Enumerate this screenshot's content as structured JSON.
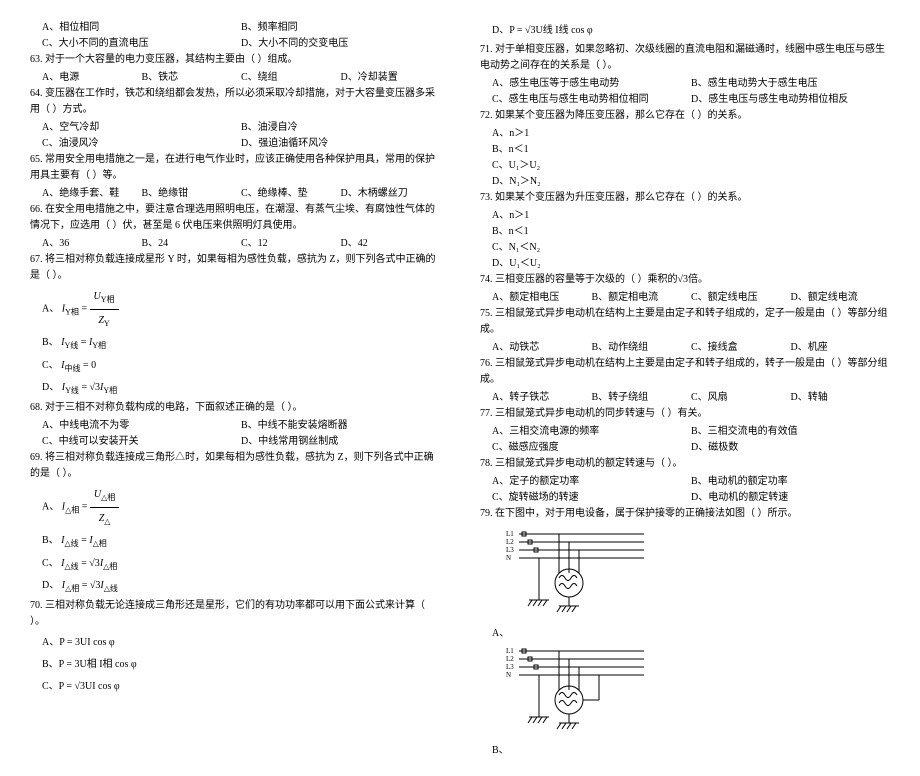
{
  "col1": {
    "q63_opts_pre": {
      "a": "A、相位相同",
      "b": "B、频率相同",
      "c": "C、大小不同的直流电压",
      "d": "D、大小不同的交变电压"
    },
    "q63": "63. 对于一个大容量的电力变压器，其结构主要由（   ）组成。",
    "q63_opts": {
      "a": "A、电源",
      "b": "B、铁芯",
      "c": "C、绕组",
      "d": "D、冷却装置"
    },
    "q64": "64. 变压器在工作时，铁芯和绕组都会发热，所以必须采取冷却措施，对于大容量变压器多采用（   ）方式。",
    "q64_opts": {
      "a": "A、空气冷却",
      "b": "B、油浸自冷",
      "c": "C、油浸风冷",
      "d": "D、强迫油循环风冷"
    },
    "q65": "65. 常用安全用电措施之一是，在进行电气作业时，应该正确使用各种保护用具，常用的保护用具主要有（   ）等。",
    "q65_opts": {
      "a": "A、绝缘手套、鞋",
      "b": "B、绝缘钳",
      "c": "C、绝缘棒、垫",
      "d": "D、木柄螺丝刀"
    },
    "q66": "66. 在安全用电措施之中，要注意合理选用照明电压，在潮湿、有蒸气尘埃、有腐蚀性气体的情况下，应选用（   ）伏，甚至是 6 伏电压来供照明灯具使用。",
    "q66_opts": {
      "a": "A、36",
      "b": "B、24",
      "c": "C、12",
      "d": "D、42"
    },
    "q67": "67. 将三相对称负载连接成星形 Y 时，如果每相为感性负载，感抗为 Z，则下列各式中正确的是（   ）。",
    "q67_a_label": "A、",
    "q67_b_label": "B、",
    "q67_c_label": "C、",
    "q67_d_label": "D、",
    "q67_formula_a_left": "I",
    "q67_formula_a_sub": "Y相",
    "q67_formula_a_num": "U",
    "q67_formula_a_numsub": "Y相",
    "q67_formula_a_den": "Z",
    "q67_formula_a_densub": "Y",
    "q67_b": "I Y线 = I Y相",
    "q67_c": "I 中线 = 0",
    "q67_d": "I Y线 = √3 I Y相",
    "q68": "68. 对于三相不对称负载构成的电路，下面叙述正确的是（   ）。",
    "q68_opts": {
      "a": "A、中线电流不为零",
      "b": "B、中线不能安装熔断器",
      "c": "C、中线可以安装开关",
      "d": "D、中线常用钢丝制成"
    },
    "q69": "69. 将三相对称负载连接成三角形△时，如果每相为感性负载，感抗为 Z，则下列各式中正确的是（   ）。",
    "q69_a_label": "A、",
    "q69_b_label": "B、",
    "q69_c_label": "C、",
    "q69_d_label": "D、",
    "q69_formula_a_left": "I",
    "q69_formula_a_sub": "△相",
    "q69_formula_a_num": "U",
    "q69_formula_a_numsub": "△相",
    "q69_formula_a_den": "Z",
    "q69_formula_a_densub": "△",
    "q69_b": "I △线 = I △相",
    "q69_c": "I △线 = √3 I △相",
    "q69_d": "I △相 = √3 I △线",
    "q70": "70. 三相对称负载无论连接成三角形还是星形，它们的有功功率都可以用下面公式来计算（   ）。",
    "q70_a": "A、P = 3UI cos φ",
    "q70_b": "B、P = 3U相 I相 cos φ",
    "q70_c": "C、P = √3UI cos φ"
  },
  "col2": {
    "q70_d": "D、P = √3U线 I线 cos φ",
    "q71": "71. 对于单相变压器，如果忽略初、次级线圈的直流电阻和漏磁通时，线圈中感生电压与感生电动势之间存在的关系是（   ）。",
    "q71_opts": {
      "a": "A、感生电压等于感生电动势",
      "b": "B、感生电动势大于感生电压",
      "c": "C、感生电压与感生电动势相位相同",
      "d": "D、感生电压与感生电动势相位相反"
    },
    "q72": "72. 如果某个变压器为降压变压器，那么它存在（   ）的关系。",
    "q72_opts": {
      "a": "A、n＞1",
      "b": "B、n＜1",
      "c": "C、U₁＞U₂",
      "d": "D、N₁＞N₂"
    },
    "q73": "73. 如果某个变压器为升压变压器，那么它存在（   ）的关系。",
    "q73_opts": {
      "a": "A、n＞1",
      "b": "B、n＜1",
      "c": "C、N₁＜N₂",
      "d": "D、U₁＜U₂"
    },
    "q74": "74. 三相变压器的容量等于次级的（   ）乘积的√3倍。",
    "q74_opts": {
      "a": "A、额定相电压",
      "b": "B、额定相电流",
      "c": "C、额定线电压",
      "d": "D、额定线电流"
    },
    "q75": "75. 三相鼠笼式异步电动机在结构上主要是由定子和转子组成的，定子一般是由（   ）等部分组成。",
    "q75_opts": {
      "a": "A、动铁芯",
      "b": "B、动作绕组",
      "c": "C、接线盒",
      "d": "D、机座"
    },
    "q76": "76. 三相鼠笼式异步电动机在结构上主要是由定子和转子组成的，转子一般是由（   ）等部分组成。",
    "q76_opts": {
      "a": "A、转子铁芯",
      "b": "B、转子绕组",
      "c": "C、风扇",
      "d": "D、转轴"
    },
    "q77": "77. 三相鼠笼式异步电动机的同步转速与（   ）有关。",
    "q77_opts": {
      "a": "A、三相交流电源的频率",
      "b": "B、三相交流电的有效值",
      "c": "C、磁感应强度",
      "d": "D、磁极数"
    },
    "q78": "78. 三相鼠笼式异步电动机的额定转速与（   ）。",
    "q78_opts": {
      "a": "A、定子的额定功率",
      "b": "B、电动机的额定功率",
      "c": "C、旋转磁场的转速",
      "d": "D、电动机的额定转速"
    },
    "q79": "79. 在下图中，对于用电设备，属于保护接零的正确接法如图（   ）所示。",
    "q79_a_label": "A、",
    "q79_b_label": "B、",
    "diagram_labels": {
      "l1": "L1",
      "l2": "L2",
      "l3": "L3",
      "n": "N"
    }
  }
}
